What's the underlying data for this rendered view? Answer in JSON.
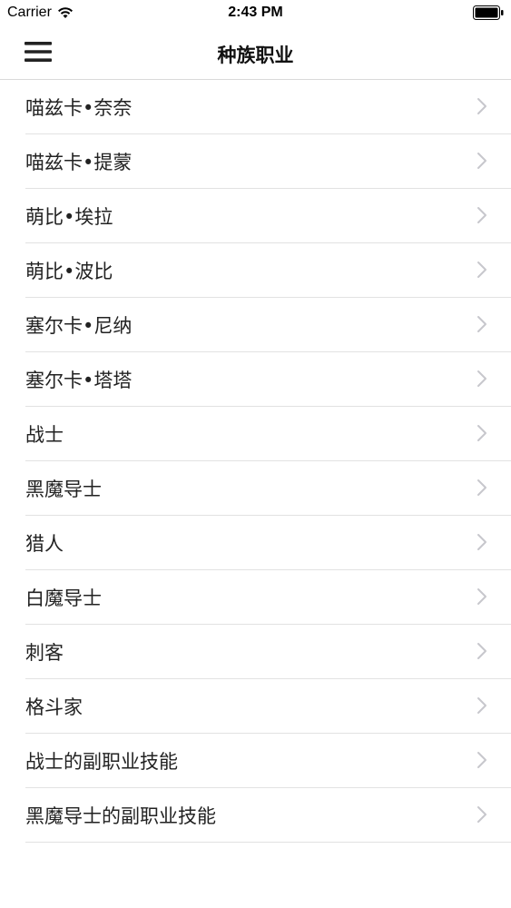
{
  "status_bar": {
    "carrier": "Carrier",
    "time": "2:43 PM"
  },
  "nav": {
    "title": "种族职业",
    "menu_icon": "hamburger-menu-icon"
  },
  "list": {
    "items": [
      {
        "label": "喵兹卡•奈奈"
      },
      {
        "label": "喵兹卡•提蒙"
      },
      {
        "label": "萌比•埃拉"
      },
      {
        "label": "萌比•波比"
      },
      {
        "label": "塞尔卡•尼纳"
      },
      {
        "label": "塞尔卡•塔塔"
      },
      {
        "label": "战士"
      },
      {
        "label": "黑魔导士"
      },
      {
        "label": "猎人"
      },
      {
        "label": "白魔导士"
      },
      {
        "label": "刺客"
      },
      {
        "label": "格斗家"
      },
      {
        "label": "战士的副职业技能"
      },
      {
        "label": "黑魔导士的副职业技能"
      }
    ],
    "chevron_icon": "chevron-right-icon"
  },
  "colors": {
    "separator": "#e2e2e2",
    "chevron": "#c7c7cc",
    "text": "#222222"
  }
}
